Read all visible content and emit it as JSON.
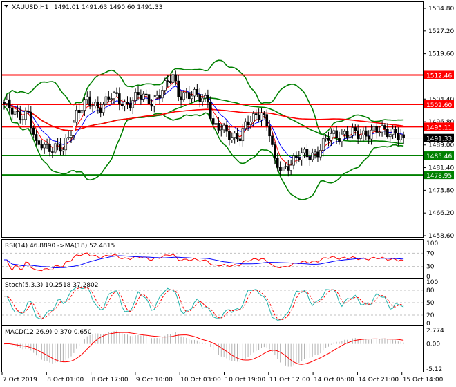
{
  "header": {
    "symbol": "XAUUSD,H1",
    "ohlc": "1491.01 1491.63 1490.60 1491.33"
  },
  "colors": {
    "bull": "#ffffff",
    "bear": "#000000",
    "red": "#ff0000",
    "green": "#008000",
    "blue": "#0000ff",
    "teal": "#20b2aa",
    "grid": "#c0c0c0"
  },
  "chart_data": [
    {
      "type": "candlestick",
      "title": "XAUUSD,H1",
      "ylim": [
        1458.6,
        1534.8
      ],
      "y_ticks": [
        "1534.80",
        "1527.20",
        "1519.60",
        "1504.40",
        "1496.80",
        "1489.00",
        "1481.40",
        "1473.80",
        "1466.20",
        "1458.60"
      ],
      "bars": 150,
      "close_anchors": [
        [
          0,
          1502
        ],
        [
          4,
          1500
        ],
        [
          9,
          1499
        ],
        [
          12,
          1488
        ],
        [
          14,
          1490
        ],
        [
          18,
          1488
        ],
        [
          22,
          1487
        ],
        [
          24,
          1492
        ],
        [
          27,
          1500
        ],
        [
          31,
          1503
        ],
        [
          35,
          1502
        ],
        [
          40,
          1505
        ],
        [
          45,
          1503
        ],
        [
          50,
          1505
        ],
        [
          55,
          1504
        ],
        [
          60,
          1508
        ],
        [
          63,
          1512
        ],
        [
          65,
          1507
        ],
        [
          70,
          1505
        ],
        [
          76,
          1505
        ],
        [
          78,
          1495
        ],
        [
          83,
          1493
        ],
        [
          88,
          1492
        ],
        [
          92,
          1497
        ],
        [
          96,
          1501
        ],
        [
          99,
          1493
        ],
        [
          101,
          1482
        ],
        [
          104,
          1481
        ],
        [
          106,
          1483
        ],
        [
          111,
          1485
        ],
        [
          117,
          1487
        ],
        [
          122,
          1492
        ],
        [
          127,
          1493
        ],
        [
          132,
          1492
        ],
        [
          137,
          1494
        ],
        [
          142,
          1493
        ],
        [
          146,
          1494
        ],
        [
          148,
          1492
        ],
        [
          149,
          1491.33
        ]
      ],
      "levels": [
        {
          "price": 1512.46,
          "label": "1512.46",
          "color": "red"
        },
        {
          "price": 1502.6,
          "label": "1502.60",
          "color": "red"
        },
        {
          "price": 1495.11,
          "label": "1495.11",
          "color": "red"
        },
        {
          "price": 1485.46,
          "label": "1485.46",
          "color": "green"
        },
        {
          "price": 1478.95,
          "label": "1478.95",
          "color": "green"
        }
      ],
      "current_price": {
        "price": 1491.33,
        "label": "1491.33"
      },
      "x_labels": [
        "7 Oct 2019",
        "8 Oct 01:00",
        "8 Oct 17:00",
        "9 Oct 10:00",
        "10 Oct 03:00",
        "10 Oct 19:00",
        "11 Oct 12:00",
        "14 Oct 05:00",
        "14 Oct 21:00",
        "15 Oct 14:00"
      ]
    },
    {
      "type": "line",
      "title": "RSI(14) 46.8890  ->MA(18) 52.4815",
      "ylim": [
        0,
        100
      ],
      "y_ticks": [
        "100",
        "70",
        "30",
        "0"
      ],
      "levels": [
        70,
        30
      ]
    },
    {
      "type": "line",
      "title": "Stoch(5,3,3) 10.2518 37.2802",
      "ylim": [
        0,
        100
      ],
      "y_ticks": [
        "100",
        "80",
        "50",
        "20",
        "0"
      ],
      "levels": [
        80,
        50,
        20
      ]
    },
    {
      "type": "bar+line",
      "title": "MACD(12,26,9) 0.370 0.650",
      "ylim": [
        -5.12,
        2.774
      ],
      "y_ticks": [
        "2.774",
        "0.00",
        "-5.12"
      ]
    }
  ]
}
